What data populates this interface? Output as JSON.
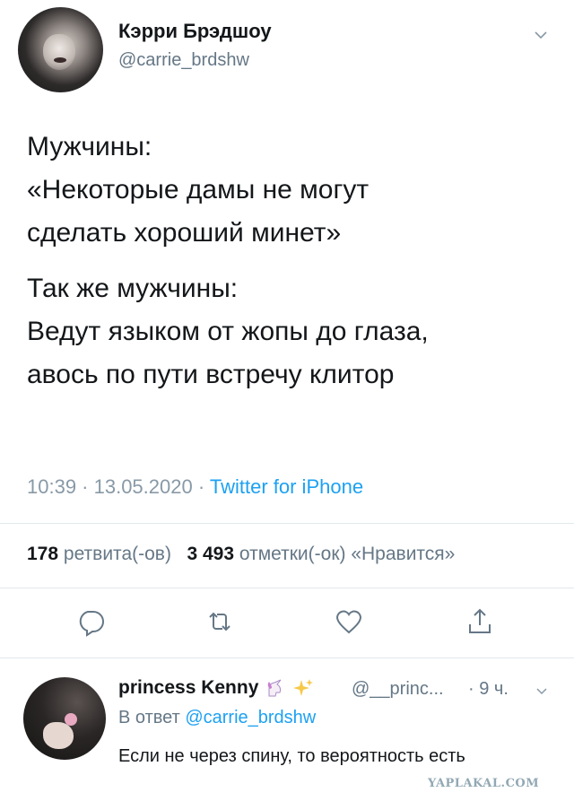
{
  "tweet": {
    "author_name": "Кэрри Брэдшоу",
    "author_handle": "@carrie_brdshw",
    "body": {
      "p1": [
        "Мужчины:",
        "«Некоторые дамы не могут",
        "сделать хороший минет»"
      ],
      "p2": [
        "Так же мужчины:",
        "Ведут языком от жопы до глаза,",
        "авось по пути встречу клитор"
      ]
    },
    "timestamp": "10:39 · 13.05.2020 · ",
    "source": "Twitter for iPhone",
    "stats": {
      "retweets_count": "178",
      "retweets_label": "ретвита(-ов)",
      "likes_count": "3 493",
      "likes_label": "отметки(-ок) «Нравится»"
    },
    "actions": [
      "reply-icon",
      "retweet-icon",
      "like-icon",
      "share-icon"
    ]
  },
  "reply": {
    "author_name": "princess Kenny",
    "author_handle": "@__princ...",
    "time": "· 9 ч.",
    "reply_prefix": "В ответ ",
    "reply_mention": "@carrie_brdshw",
    "text": "Если не через спину, то вероятность есть"
  },
  "watermark": "YAPLAKAL.COM",
  "colors": {
    "text": "#14171a",
    "secondary": "#657786",
    "accent": "#1da1f2",
    "divider": "#e1e8ed"
  }
}
